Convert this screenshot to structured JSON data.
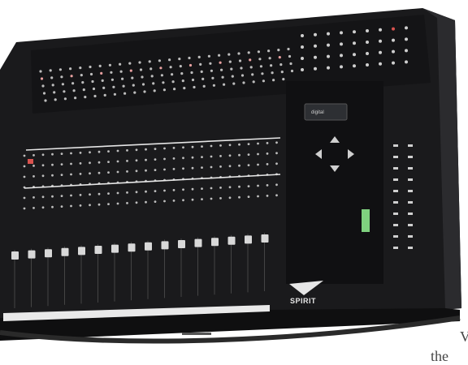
{
  "image": {
    "subject": "digital mixing console",
    "brand_text": "SPIRIT",
    "display_text": "digital",
    "caption_fragments": [
      "V",
      "the"
    ]
  },
  "palette": {
    "console_body": "#1a1a1c",
    "console_edge": "#2b2b2e",
    "panel": "#121214",
    "fader_cap": "#d8d8d8",
    "strip": "#e9e9e9",
    "led_red": "#d9534f",
    "led_green": "#7fd17f",
    "knob": "#bdbdbd"
  }
}
